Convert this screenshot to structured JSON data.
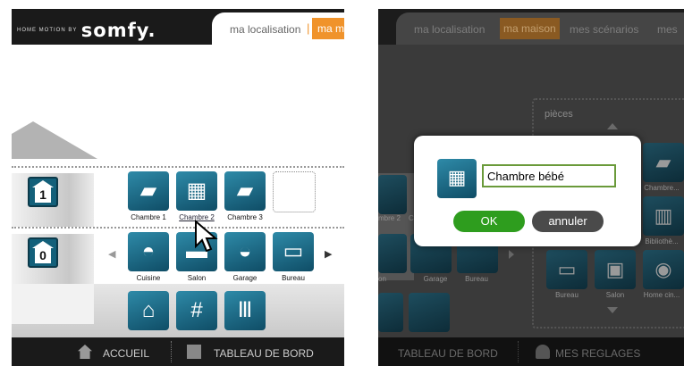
{
  "left_panel": {
    "brand_small": "HOME MOTION BY",
    "brand_logo": "somfy.",
    "nav": {
      "localisation": "ma localisation",
      "separator": "|",
      "maison_partial": "ma ma"
    },
    "floors": [
      {
        "label": "1",
        "rooms": [
          {
            "name": "Chambre 1",
            "icon": "bedroom-icon"
          },
          {
            "name": "Chambre 2",
            "icon": "crib-icon",
            "hovered": true
          },
          {
            "name": "Chambre 3",
            "icon": "bedroom-icon"
          },
          {
            "name": "",
            "icon": "empty-slot"
          }
        ]
      },
      {
        "label": "0",
        "rooms": [
          {
            "name": "Cuisine",
            "icon": "pot-icon"
          },
          {
            "name": "Salon",
            "icon": "sofa-icon"
          },
          {
            "name": "Garage",
            "icon": "car-icon"
          },
          {
            "name": "Bureau",
            "icon": "laptop-icon"
          }
        ]
      }
    ],
    "outdoor_icons": [
      "awning-icon",
      "fence-icon",
      "gate-icon"
    ],
    "footer": {
      "accueil": "ACCUEIL",
      "tableau": "TABLEAU DE BORD"
    }
  },
  "right_panel": {
    "nav": {
      "localisation": "ma localisation",
      "maison": "ma maison",
      "scenarios": "mes scénarios",
      "mes": "mes"
    },
    "pieces_label": "pièces",
    "room_labels": {
      "chambre_partial": "Chambre...",
      "biblio_partial": "Bibliothè...",
      "bureau": "Bureau",
      "salon": "Salon",
      "home_cinema": "Home cin...",
      "left_chambre": "mbre 2",
      "left_c": "C",
      "on": "on",
      "garage": "Garage",
      "bureau_left": "Bureau"
    },
    "dialog": {
      "input_value": "Chambre bébé",
      "ok": "OK",
      "cancel": "annuler"
    },
    "footer": {
      "tableau": "TABLEAU DE BORD",
      "reglages": "MES REGLAGES"
    }
  }
}
